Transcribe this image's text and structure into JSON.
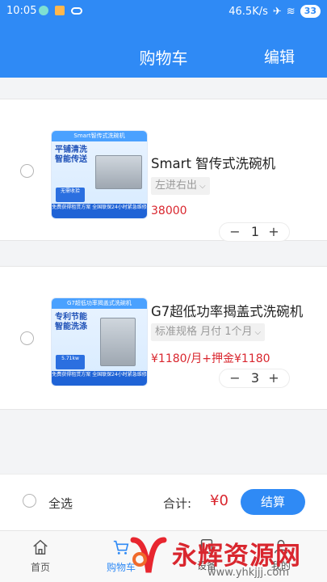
{
  "status_bar": {
    "time": "10:05",
    "speed": "46.5K/s",
    "battery": "33"
  },
  "header": {
    "title": "购物车",
    "edit_label": "编辑"
  },
  "cart": {
    "items": [
      {
        "name": "Smart 智传式洗碗机",
        "spec": "左进右出",
        "price": "38000",
        "quantity": "1",
        "thumb": {
          "top": "Smart智传式洗碗机",
          "headline": "平铺清洗\n智能传送",
          "badge": "无需收拾",
          "footer": "免费获得租赁方案 全国联保24小时紧急维修"
        }
      },
      {
        "name": "G7超低功率揭盖式洗碗机",
        "spec": "标准规格 月付 1个月",
        "price": "¥1180/月+押金¥1180",
        "quantity": "3",
        "thumb": {
          "top": "G7超低功率揭盖式洗碗机",
          "headline": "专利节能\n智能洗涤",
          "badge": "5.71kw",
          "footer": "免费获得租赁方案 全国联保24小时紧急维修"
        }
      }
    ]
  },
  "footer": {
    "select_all": "全选",
    "total_label": "合计:",
    "total_value": "¥0",
    "checkout_label": "结算"
  },
  "tabs": [
    {
      "label": "首页",
      "icon": "house-icon"
    },
    {
      "label": "购物车",
      "icon": "cart-icon"
    },
    {
      "label": "设备",
      "icon": "device-icon"
    },
    {
      "label": "我的",
      "icon": "user-icon"
    }
  ],
  "watermark": {
    "text": "永辉资源网",
    "url": "www.yhkjjj.com"
  },
  "colors": {
    "brand_blue": "#2f8af5",
    "price_red": "#d9262e"
  }
}
